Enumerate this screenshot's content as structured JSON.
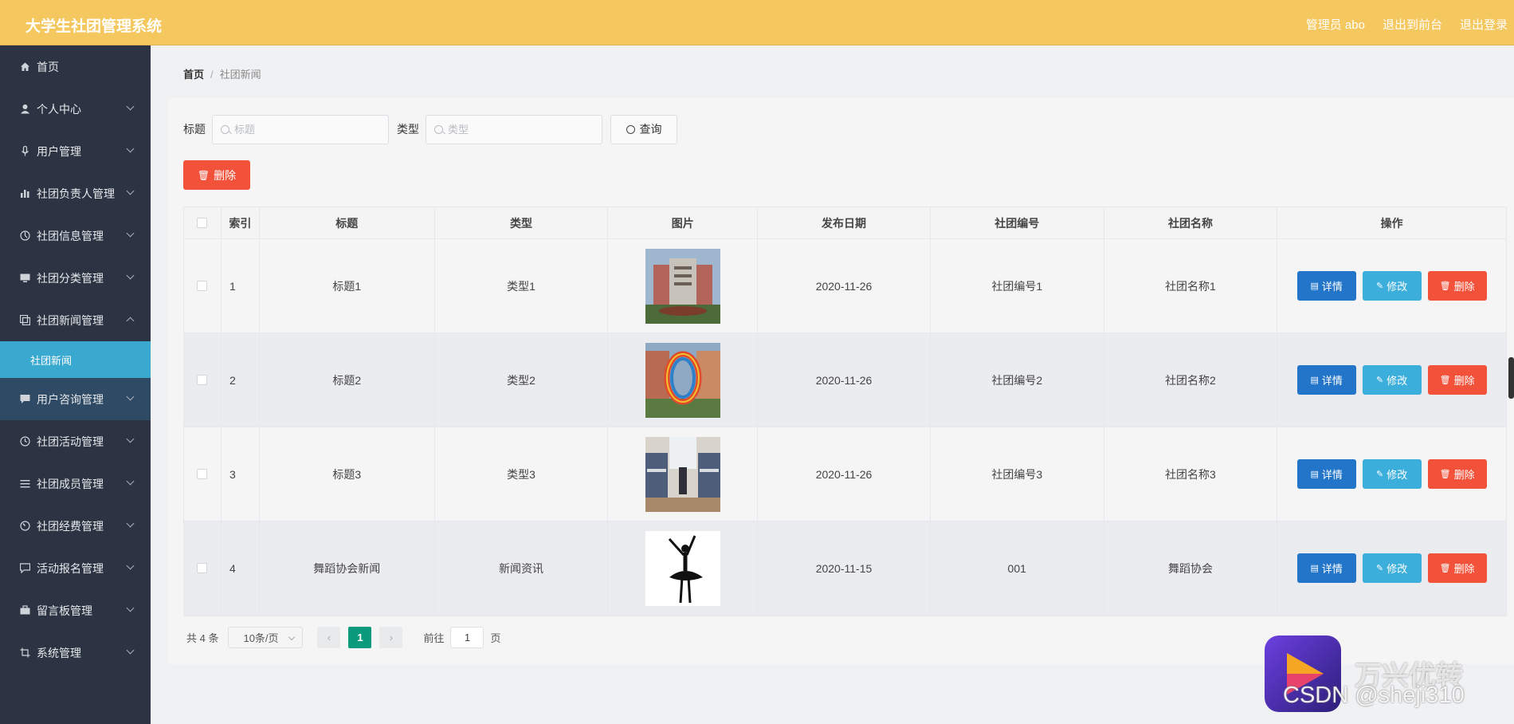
{
  "header": {
    "title": "大学生社团管理系统",
    "admin": "管理员 abo",
    "to_front": "退出到前台",
    "logout": "退出登录"
  },
  "sidebar": {
    "items": [
      {
        "label": "首页",
        "icon": "home-icon"
      },
      {
        "label": "个人中心",
        "icon": "user-icon"
      },
      {
        "label": "用户管理",
        "icon": "mic-icon"
      },
      {
        "label": "社团负责人管理",
        "icon": "bar-chart-icon"
      },
      {
        "label": "社团信息管理",
        "icon": "compass-icon"
      },
      {
        "label": "社团分类管理",
        "icon": "monitor-icon"
      },
      {
        "label": "社团新闻管理",
        "icon": "copy-icon"
      },
      {
        "label": "用户咨询管理",
        "icon": "chat-icon"
      },
      {
        "label": "社团活动管理",
        "icon": "clock-icon"
      },
      {
        "label": "社团成员管理",
        "icon": "list-icon"
      },
      {
        "label": "社团经费管理",
        "icon": "gauge-icon"
      },
      {
        "label": "活动报名管理",
        "icon": "message-icon"
      },
      {
        "label": "留言板管理",
        "icon": "briefcase-icon"
      },
      {
        "label": "系统管理",
        "icon": "crop-icon"
      }
    ],
    "active_sub": "社团新闻"
  },
  "breadcrumb": {
    "home": "首页",
    "current": "社团新闻"
  },
  "search": {
    "title_label": "标题",
    "title_placeholder": "标题",
    "type_label": "类型",
    "type_placeholder": "类型",
    "query_label": "查询"
  },
  "delete_label": "删除",
  "table": {
    "headers": [
      "索引",
      "标题",
      "类型",
      "图片",
      "发布日期",
      "社团编号",
      "社团名称",
      "操作"
    ],
    "rows": [
      {
        "index": "1",
        "title": "标题1",
        "type": "类型1",
        "date": "2020-11-26",
        "club_no": "社团编号1",
        "club_name": "社团名称1"
      },
      {
        "index": "2",
        "title": "标题2",
        "type": "类型2",
        "date": "2020-11-26",
        "club_no": "社团编号2",
        "club_name": "社团名称2"
      },
      {
        "index": "3",
        "title": "标题3",
        "type": "类型3",
        "date": "2020-11-26",
        "club_no": "社团编号3",
        "club_name": "社团名称3"
      },
      {
        "index": "4",
        "title": "舞蹈协会新闻",
        "type": "新闻资讯",
        "date": "2020-11-15",
        "club_no": "001",
        "club_name": "舞蹈协会"
      }
    ],
    "actions": {
      "detail": "详情",
      "edit": "修改",
      "delete": "删除"
    }
  },
  "pager": {
    "total": "共 4 条",
    "page_size": "10条/页",
    "current": "1",
    "goto_prefix": "前往",
    "goto_value": "1",
    "goto_suffix": "页"
  },
  "watermark": {
    "brand": "万兴优转",
    "csdn": "CSDN @sheji310"
  }
}
